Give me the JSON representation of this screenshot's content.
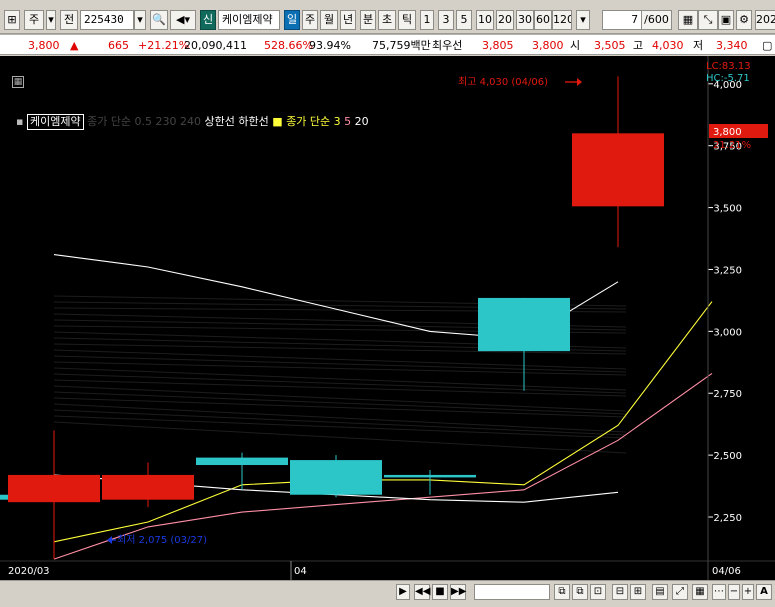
{
  "toolbar": {
    "market_code": "주",
    "prefix": "전",
    "stock_code": "225430",
    "new_badge": "신",
    "stock_name": "케이엠제약",
    "periods": [
      "일",
      "주",
      "월",
      "년",
      "분",
      "초",
      "틱"
    ],
    "active_period": "일",
    "intervals": [
      "1",
      "3",
      "5",
      "10",
      "20",
      "30",
      "60",
      "120"
    ],
    "count": "7",
    "count_total": "/600",
    "right_value": "202"
  },
  "quote": {
    "price": "3,800",
    "change_symbol": "▲",
    "change": "665",
    "change_rate": "+21.21%",
    "volume": "20,090,411",
    "volume_rate": "528.66%",
    "ratio": "93.94%",
    "amount": "75,759백만",
    "best_ask_label": "최우선",
    "best_ask": "3,805",
    "best_bid": "3,800",
    "open_label": "시",
    "open": "3,505",
    "high_label": "고",
    "high": "4,030",
    "low_label": "저",
    "low": "3,340"
  },
  "legend": {
    "name": "케이엠제약",
    "faded": "종가 단순 0.5  230  240",
    "upper": "상한선",
    "lower": "하한선",
    "ma_label": "종가 단순",
    "ma3": "3",
    "ma5": "5",
    "ma20": "20"
  },
  "annotations": {
    "high": "최고 4,030 (04/06)",
    "low": "최저 2,075 (03/27)",
    "lc": "LC:83.13",
    "hc": "HC:-5.71",
    "price_tag": "3,800",
    "price_rate": "21.21%"
  },
  "colors": {
    "up": "#e01a0e",
    "down": "#2cc6c9",
    "ma3": "#ffff3a",
    "ma5": "#ff8fa5",
    "ma20": "#ffffff",
    "background": "#000000"
  },
  "chart_data": {
    "type": "candlestick",
    "ylim": [
      2040,
      4080
    ],
    "yticks": [
      "2,250",
      "2,500",
      "2,750",
      "3,000",
      "3,250",
      "3,500",
      "3,750",
      "4,000"
    ],
    "ytick_values": [
      2250,
      2500,
      2750,
      3000,
      3250,
      3500,
      3750,
      4000
    ],
    "xlabels": [
      "2020/03",
      "04",
      "04/06"
    ],
    "candles": [
      {
        "o": 2340,
        "h": 2340,
        "l": 2320,
        "c": 2320
      },
      {
        "o": 2310,
        "h": 2600,
        "l": 2080,
        "c": 2420
      },
      {
        "o": 2320,
        "h": 2470,
        "l": 2290,
        "c": 2420
      },
      {
        "o": 2490,
        "h": 2510,
        "l": 2360,
        "c": 2460
      },
      {
        "o": 2480,
        "h": 2500,
        "l": 2330,
        "c": 2340
      },
      {
        "o": 2420,
        "h": 2440,
        "l": 2340,
        "c": 2410
      },
      {
        "o": 3135,
        "h": 3135,
        "l": 2760,
        "c": 2920
      },
      {
        "o": 3505,
        "h": 4030,
        "l": 3340,
        "c": 3800
      }
    ],
    "series": [
      {
        "name": "3",
        "values": [
          null,
          2150,
          2230,
          2380,
          2400,
          2400,
          2380,
          2620,
          3120
        ]
      },
      {
        "name": "5",
        "values": [
          null,
          2080,
          2210,
          2270,
          2300,
          2330,
          2360,
          2560,
          2830
        ]
      },
      {
        "name": "20",
        "values": [
          null,
          3310,
          3260,
          3180,
          3090,
          3000,
          2970,
          3200,
          null
        ]
      },
      {
        "name": "하한선",
        "values": [
          null,
          2420,
          2390,
          2360,
          2340,
          2320,
          2310,
          2350,
          null
        ]
      }
    ]
  }
}
